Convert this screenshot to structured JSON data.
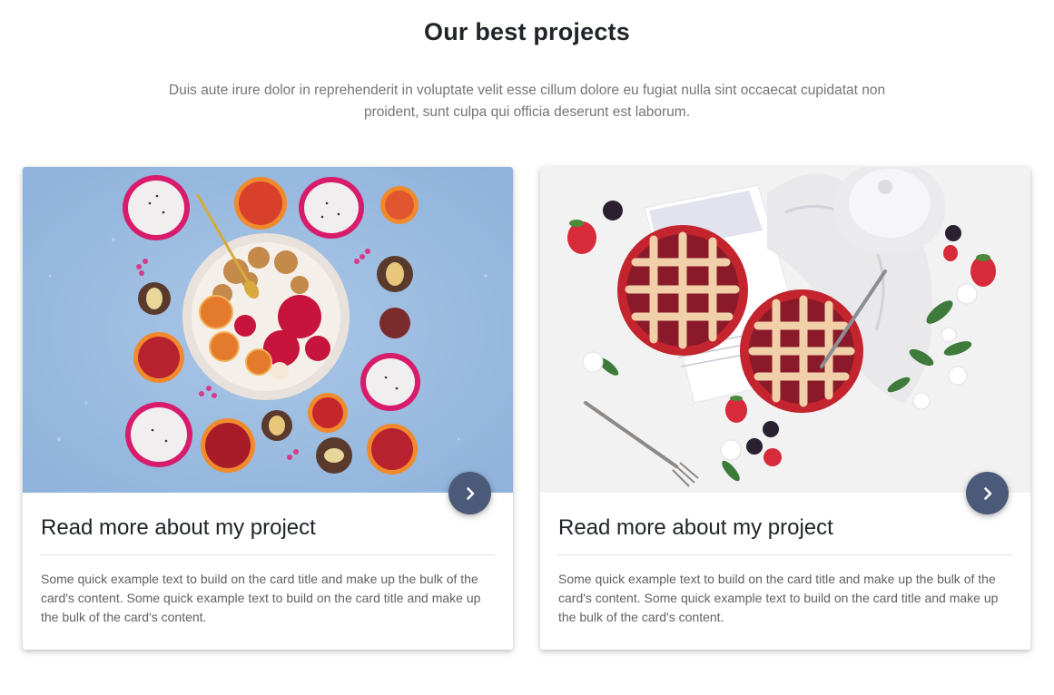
{
  "section": {
    "title": "Our best projects",
    "lead": "Duis aute irure dolor in reprehenderit in voluptate velit esse cillum dolore eu fugiat nulla sint occaecat cupidatat non proident, sunt culpa qui officia deserunt est laborum."
  },
  "cards": [
    {
      "title": "Read more about my project",
      "text": "Some quick example text to build on the card title and make up the bulk of the card's content. Some quick example text to build on the card title and make up the bulk of the card's content.",
      "image": "fruit-bowl-photo",
      "button_icon": "chevron-right-icon"
    },
    {
      "title": "Read more about my project",
      "text": "Some quick example text to build on the card title and make up the bulk of the card's content. Some quick example text to build on the card title and make up the bulk of the card's content.",
      "image": "berry-pie-photo",
      "button_icon": "chevron-right-icon"
    }
  ],
  "colors": {
    "fab": "#4b5a78",
    "title": "#212529",
    "lead": "#757575",
    "body_text": "#616161"
  }
}
